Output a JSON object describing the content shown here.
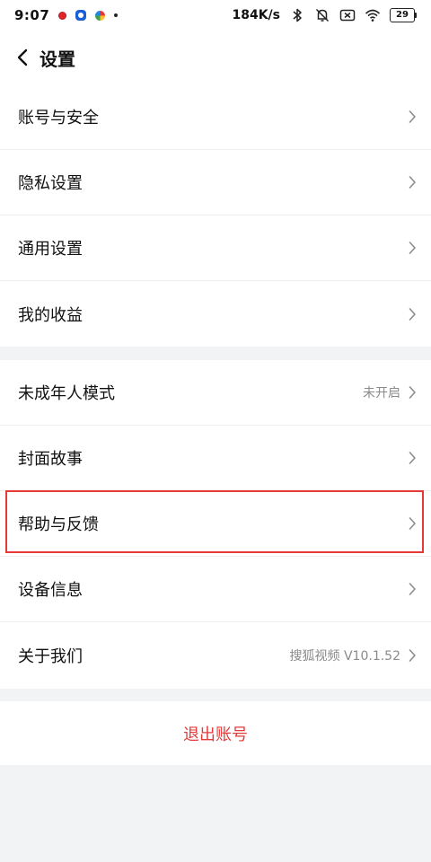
{
  "status_bar": {
    "time": "9:07",
    "network_speed": "184K/s",
    "battery": "29"
  },
  "header": {
    "title": "设置"
  },
  "group1": {
    "items": [
      {
        "label": "账号与安全",
        "value": ""
      },
      {
        "label": "隐私设置",
        "value": ""
      },
      {
        "label": "通用设置",
        "value": ""
      },
      {
        "label": "我的收益",
        "value": ""
      }
    ]
  },
  "group2": {
    "items": [
      {
        "label": "未成年人模式",
        "value": "未开启"
      },
      {
        "label": "封面故事",
        "value": ""
      },
      {
        "label": "帮助与反馈",
        "value": ""
      },
      {
        "label": "设备信息",
        "value": ""
      },
      {
        "label": "关于我们",
        "value": "搜狐视频 V10.1.52"
      }
    ]
  },
  "logout": {
    "label": "退出账号"
  },
  "colors": {
    "logout_text": "#e23b3b",
    "highlight": "#e53935",
    "page_bg": "#f2f3f5"
  },
  "icons": {
    "back": "chevron-left-icon",
    "row_arrow": "chevron-right-icon"
  }
}
